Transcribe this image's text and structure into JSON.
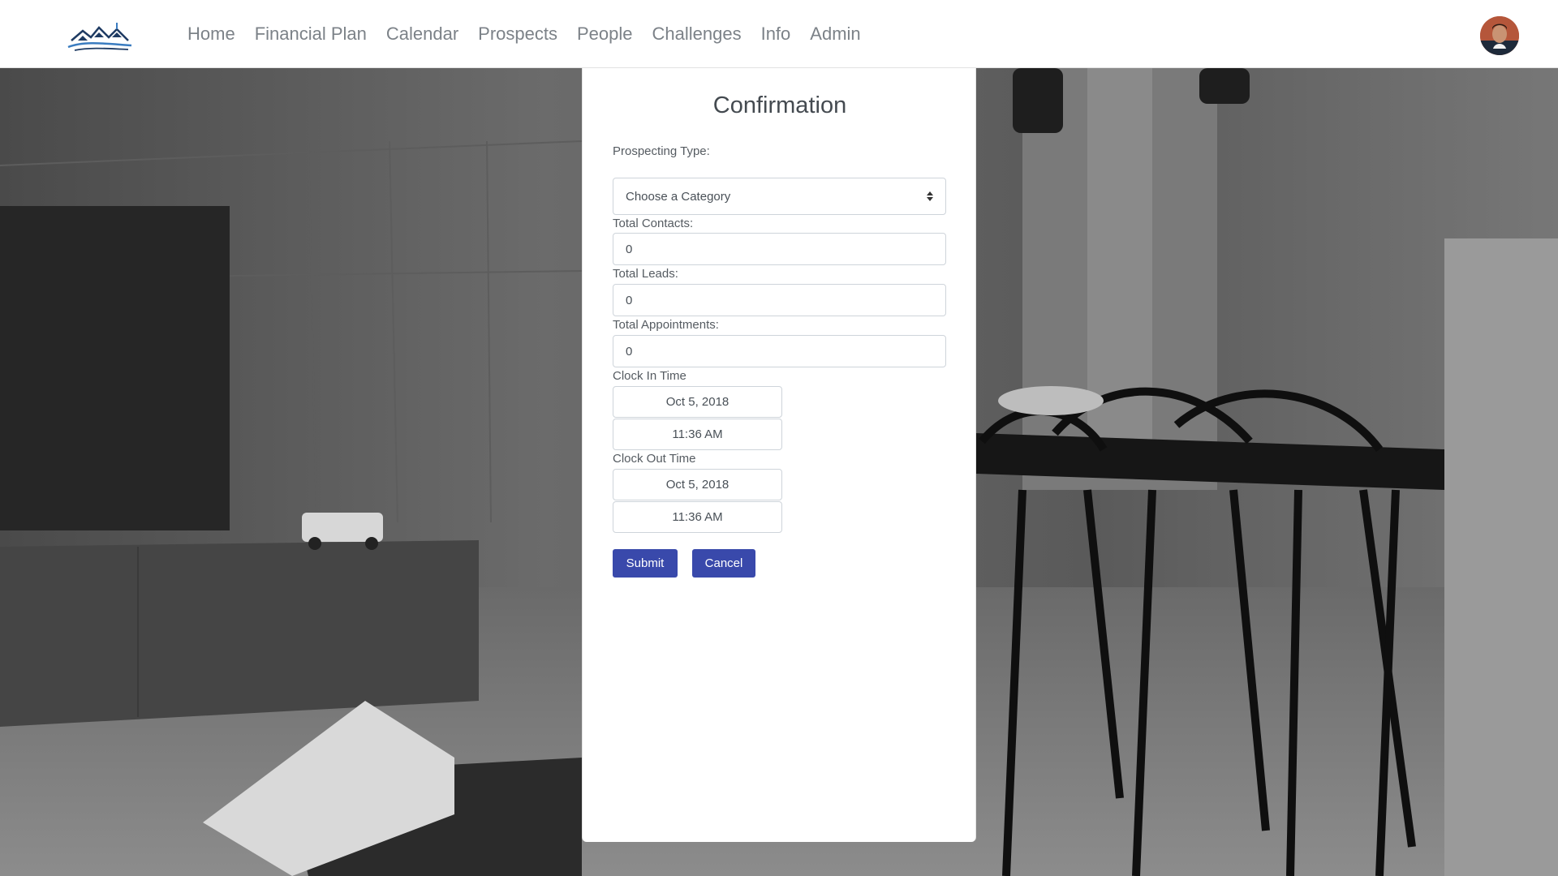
{
  "nav": {
    "links": [
      "Home",
      "Financial Plan",
      "Calendar",
      "Prospects",
      "People",
      "Challenges",
      "Info",
      "Admin"
    ]
  },
  "modal": {
    "title": "Confirmation",
    "prospecting_type_label": "Prospecting Type:",
    "prospecting_type_value": "Choose a Category",
    "total_contacts_label": "Total Contacts:",
    "total_contacts_value": "0",
    "total_leads_label": "Total Leads:",
    "total_leads_value": "0",
    "total_appointments_label": "Total Appointments:",
    "total_appointments_value": "0",
    "clock_in_label": "Clock In Time",
    "clock_in_date": "Oct 5, 2018",
    "clock_in_time": "11:36 AM",
    "clock_out_label": "Clock Out Time",
    "clock_out_date": "Oct 5, 2018",
    "clock_out_time": "11:36 AM",
    "submit_label": "Submit",
    "cancel_label": "Cancel"
  },
  "colors": {
    "primary_button": "#3949ab",
    "nav_text": "#7c8288",
    "logo_navy": "#1f3b63"
  }
}
